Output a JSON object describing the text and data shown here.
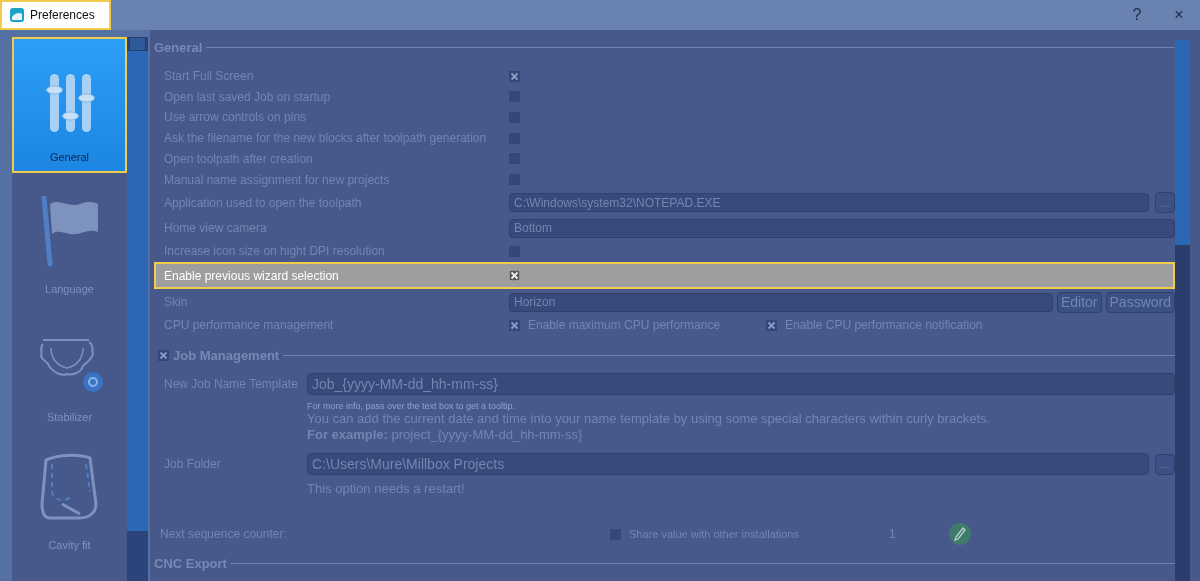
{
  "window": {
    "title": "Preferences",
    "buttons": [
      "?",
      "×"
    ]
  },
  "sidebar": {
    "items": [
      {
        "label": "General",
        "selected": true
      },
      {
        "label": "Language",
        "selected": false
      },
      {
        "label": "Stabilizer",
        "selected": false
      },
      {
        "label": "Cavity fit",
        "selected": false
      }
    ]
  },
  "general": {
    "title": "General",
    "rows": [
      {
        "kind": "checkbox",
        "label": "Start Full Screen",
        "checked": true,
        "highlighted": false
      },
      {
        "kind": "checkbox",
        "label": "Open last saved Job on startup",
        "checked": false,
        "highlighted": false
      },
      {
        "kind": "checkbox",
        "label": "Use arrow controls on pins",
        "checked": false,
        "highlighted": false
      },
      {
        "kind": "checkbox",
        "label": "Ask the filename for the new blocks after toolpath generation",
        "checked": false,
        "highlighted": false
      },
      {
        "kind": "checkbox",
        "label": "Open toolpath after creation",
        "checked": false,
        "highlighted": false
      },
      {
        "kind": "checkbox",
        "label": "Manual name assignment for new projects",
        "checked": false,
        "highlighted": false
      },
      {
        "kind": "path",
        "label": "Application used to open the toolpath",
        "value": "C:\\Windows\\system32\\NOTEPAD.EXE",
        "button": "...",
        "highlighted": false
      },
      {
        "kind": "dropdown",
        "label": "Home view camera",
        "value": "Bottom",
        "highlighted": false
      },
      {
        "kind": "checkbox",
        "label": "Increase icon size on hight DPI resolution",
        "checked": false,
        "highlighted": false
      },
      {
        "kind": "checkbox",
        "label": "Enable previous wizard selection",
        "checked": true,
        "highlighted": true
      },
      {
        "kind": "skin",
        "label": "Skin",
        "value": "Horizon",
        "buttons": [
          "Editor",
          "Password"
        ],
        "highlighted": false
      },
      {
        "kind": "options",
        "label": "CPU performance management",
        "highlighted": false,
        "options": [
          {
            "label": "Enable maximum CPU performance",
            "checked": true
          },
          {
            "label": "Enable CPU performance notification",
            "checked": true
          }
        ]
      }
    ]
  },
  "job_management": {
    "title": "Job Management",
    "checked": true,
    "template": {
      "label": "New Job Name Template",
      "value": "Job_{yyyy-MM-dd_hh-mm-ss}",
      "tip": "For more info, pass over the text box to get a tooltip.",
      "hint": "You can add the current date and time into your name template by using some special characters within curly brackets.",
      "example": "**For example:** project_{yyyy-MM-dd_hh-mm-ss}"
    },
    "folder": {
      "label": "Job Folder",
      "value": "C:\\Users\\Mure\\Millbox Projects",
      "button": "...",
      "note": "This option needs a restart!"
    },
    "counter": {
      "label": "Next sequence counter:",
      "share": {
        "label": "Share value with other installations",
        "checked": false
      },
      "value": "1"
    }
  },
  "cnc_export": {
    "title": "CNC Export"
  }
}
